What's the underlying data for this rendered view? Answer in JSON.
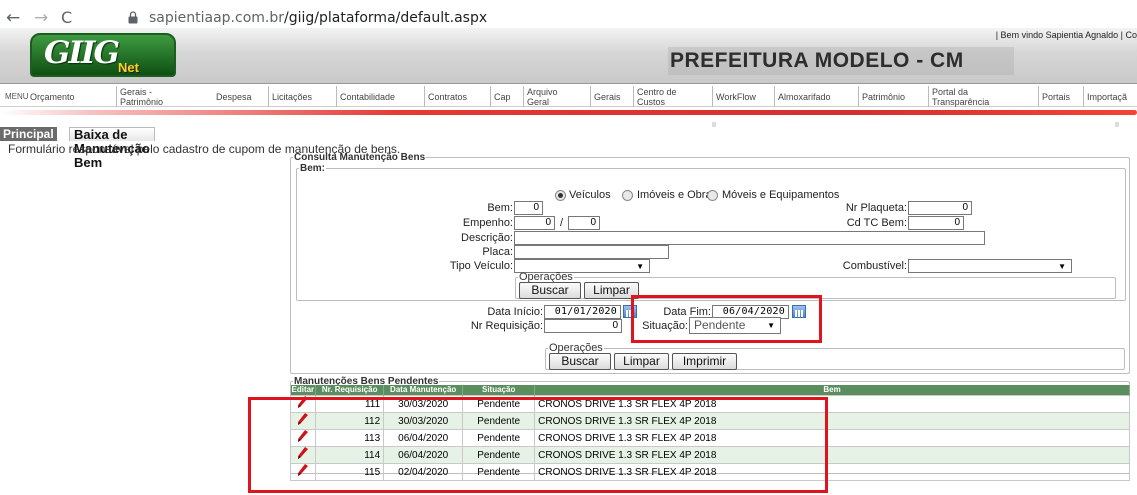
{
  "browser": {
    "back_icon": "←",
    "forward_icon": "→",
    "reload_icon": "C",
    "lock_icon": "lock-icon",
    "url_domain": "sapientiaap.com.br",
    "url_path": "/giig/plataforma/default.aspx"
  },
  "header": {
    "welcome": "| Bem vindo Sapientia Agnaldo   |  Co",
    "logo_main": "GIIG",
    "logo_sub": "Net",
    "org_name": "PREFEITURA MODELO - CM"
  },
  "menu": {
    "label": "MENU",
    "items": [
      {
        "label": "Orçamento"
      },
      {
        "label": "Gerais - Patrimônio"
      },
      {
        "label": "Despesa"
      },
      {
        "label": "Licitações"
      },
      {
        "label": "Contabilidade"
      },
      {
        "label": "Contratos"
      },
      {
        "label": "Cap"
      },
      {
        "label": "Arquivo Geral"
      },
      {
        "label": "Gerais"
      },
      {
        "label": "Centro de Custos"
      },
      {
        "label": "WorkFlow"
      },
      {
        "label": "Almoxarifado"
      },
      {
        "label": "Patrimônio"
      },
      {
        "label": "Portal da Transparência"
      },
      {
        "label": "Portais"
      },
      {
        "label": "Importaçã"
      }
    ]
  },
  "tabs": {
    "principal": "Principal",
    "active": "Baixa de Manutenção Bem"
  },
  "description": "Formulário responsável pelo cadastro de cupom de manutenção de bens.",
  "consulta": {
    "legend": "Consulta Manutenção Bens",
    "bem_legend": "Bem:",
    "radios": [
      {
        "label": "Veículos",
        "checked": true
      },
      {
        "label": "Imóveis e Obras",
        "checked": false
      },
      {
        "label": "Móveis e Equipamentos",
        "checked": false
      }
    ],
    "fields": {
      "bem_label": "Bem:",
      "bem_value": "0",
      "nr_plaqueta_label": "Nr Plaqueta:",
      "nr_plaqueta_value": "0",
      "empenho_label": "Empenho:",
      "empenho_value1": "0",
      "empenho_sep": "/",
      "empenho_value2": "0",
      "cd_tc_label": "Cd TC Bem:",
      "cd_tc_value": "0",
      "descricao_label": "Descrição:",
      "descricao_value": "",
      "placa_label": "Placa:",
      "placa_value": "",
      "tipo_veiculo_label": "Tipo Veículo:",
      "tipo_veiculo_value": "",
      "combustivel_label": "Combustível:",
      "combustivel_value": ""
    },
    "operacoes_legend": "Operações",
    "buscar": "Buscar",
    "limpar": "Limpar",
    "data_inicio_label": "Data Início:",
    "data_inicio_value": "01/01/2020",
    "data_fim_label": "Data Fim:",
    "data_fim_value": "06/04/2020",
    "nr_requisicao_label": "Nr Requisição:",
    "nr_requisicao_value": "0",
    "situacao_label": "Situação:",
    "situacao_value": "Pendente",
    "operacoes2_legend": "Operações",
    "buscar2": "Buscar",
    "limpar2": "Limpar",
    "imprimir": "Imprimir"
  },
  "pendentes": {
    "legend": "Manutenções Bens Pendentes",
    "columns": [
      "Editar",
      "Nr. Requisição",
      "Data Manutenção",
      "Situação",
      "Bem"
    ],
    "rows": [
      {
        "nr": "111",
        "data": "30/03/2020",
        "situacao": "Pendente",
        "bem": "CRONOS DRIVE 1.3 SR FLEX 4P 2018"
      },
      {
        "nr": "112",
        "data": "30/03/2020",
        "situacao": "Pendente",
        "bem": "CRONOS DRIVE 1.3 SR FLEX 4P 2018"
      },
      {
        "nr": "113",
        "data": "06/04/2020",
        "situacao": "Pendente",
        "bem": "CRONOS DRIVE 1.3 SR FLEX 4P 2018"
      },
      {
        "nr": "114",
        "data": "06/04/2020",
        "situacao": "Pendente",
        "bem": "CRONOS DRIVE 1.3 SR FLEX 4P 2018"
      },
      {
        "nr": "115",
        "data": "02/04/2020",
        "situacao": "Pendente",
        "bem": "CRONOS DRIVE 1.3 SR FLEX 4P 2018"
      }
    ]
  },
  "colors": {
    "header_green": "#5b8e5e",
    "row_alt": "#e7f2e6",
    "annotation_red": "#e0141c",
    "menu_red": "#e53935"
  }
}
